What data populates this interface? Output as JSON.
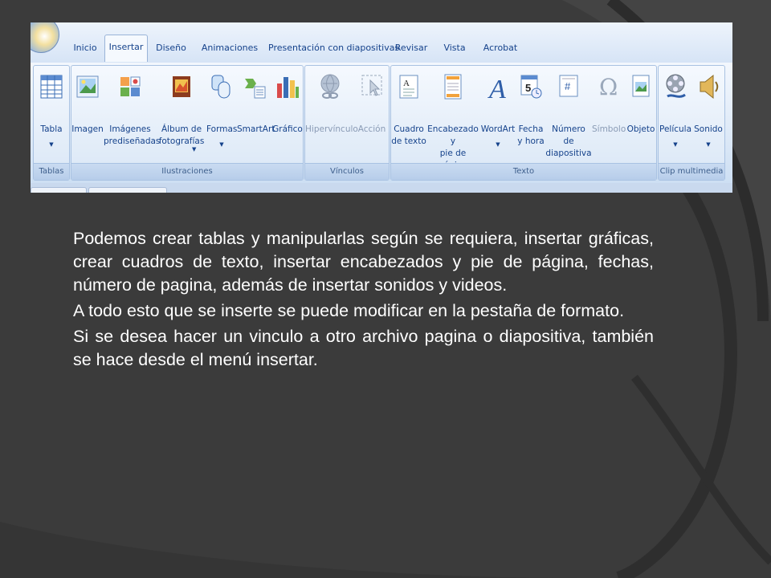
{
  "ribbon": {
    "tabs": [
      "Inicio",
      "Insertar",
      "Diseño",
      "Animaciones",
      "Presentación con diapositivas",
      "Revisar",
      "Vista",
      "Acrobat"
    ],
    "active_tab": "Insertar",
    "groups": [
      {
        "label": "Tablas",
        "commands": [
          {
            "label": "Tabla",
            "icon": "table-icon",
            "dropdown": true
          }
        ]
      },
      {
        "label": "Ilustraciones",
        "commands": [
          {
            "label": "Imagen",
            "icon": "picture-icon"
          },
          {
            "label": "Imágenes\nprediseñadas",
            "icon": "clipart-icon"
          },
          {
            "label": "Álbum de\nfotografías",
            "icon": "photo-album-icon",
            "dropdown": true
          },
          {
            "label": "Formas",
            "icon": "shapes-icon",
            "dropdown": true
          },
          {
            "label": "SmartArt",
            "icon": "smartart-icon"
          },
          {
            "label": "Gráfico",
            "icon": "chart-icon"
          }
        ]
      },
      {
        "label": "Vínculos",
        "commands": [
          {
            "label": "Hipervínculo",
            "icon": "hyperlink-icon",
            "disabled": true
          },
          {
            "label": "Acción",
            "icon": "action-icon",
            "disabled": true
          }
        ]
      },
      {
        "label": "Texto",
        "commands": [
          {
            "label": "Cuadro\nde texto",
            "icon": "text-box-icon"
          },
          {
            "label": "Encabezado y\npie de página",
            "icon": "header-footer-icon"
          },
          {
            "label": "WordArt",
            "icon": "wordart-icon",
            "dropdown": true
          },
          {
            "label": "Fecha\ny hora",
            "icon": "date-time-icon"
          },
          {
            "label": "Número de\ndiapositiva",
            "icon": "slide-number-icon"
          },
          {
            "label": "Símbolo",
            "icon": "symbol-icon",
            "disabled": true
          },
          {
            "label": "Objeto",
            "icon": "object-icon"
          }
        ]
      },
      {
        "label": "Clip multimedia",
        "commands": [
          {
            "label": "Película",
            "icon": "movie-icon",
            "dropdown": true
          },
          {
            "label": "Sonido",
            "icon": "sound-icon",
            "dropdown": true
          }
        ]
      }
    ]
  },
  "body": {
    "paragraphs": [
      "Podemos crear tablas y manipularlas según se requiera, insertar gráficas, crear cuadros de texto, insertar encabezados y pie de página, fechas, número de pagina, además de insertar sonidos y videos.",
      "A todo esto que  se inserte se puede modificar en la pestaña de formato.",
      "Si se desea hacer un vinculo a otro archivo pagina o diapositiva,  también se hace desde el menú insertar."
    ]
  },
  "colors": {
    "slide_background": "#3a3a3a",
    "arc": "#4a4a4a",
    "body_text": "#ffffff",
    "ribbon_text": "#15428b"
  }
}
